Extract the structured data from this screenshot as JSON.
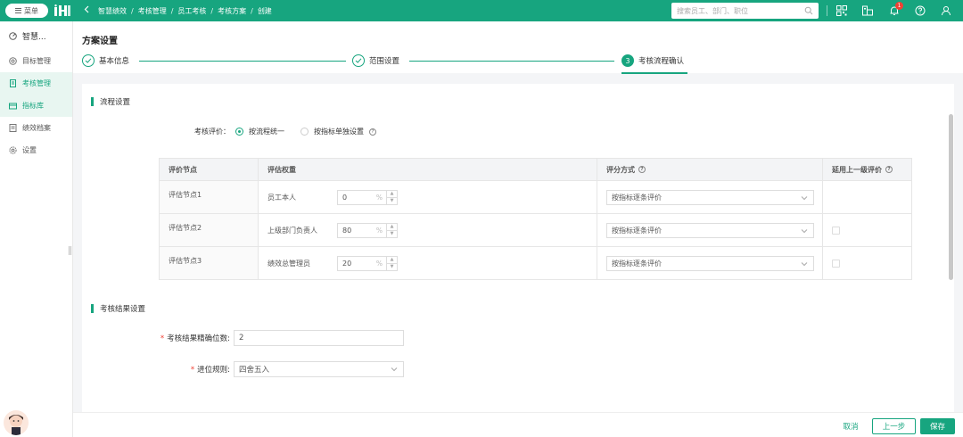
{
  "colors": {
    "brand": "#17a57f",
    "badge": "#f04134"
  },
  "topbar": {
    "menu_label": "菜单",
    "breadcrumb": [
      "智慧绩效",
      "考核管理",
      "员工考核",
      "考核方案",
      "创建"
    ],
    "search_placeholder": "搜索员工、部门、职位",
    "notification_count": "1",
    "icons": [
      "qrcode-icon",
      "org-icon",
      "bell-icon",
      "help-icon",
      "user-icon"
    ]
  },
  "sidebar": {
    "head": "智慧...",
    "items": [
      {
        "label": "目标管理",
        "icon": "target-icon"
      },
      {
        "label": "考核管理",
        "icon": "document-icon"
      },
      {
        "label": "指标库",
        "icon": "box-icon"
      },
      {
        "label": "绩效档案",
        "icon": "archive-icon"
      },
      {
        "label": "设置",
        "icon": "gear-icon"
      }
    ]
  },
  "page": {
    "title": "方案设置",
    "steps": [
      {
        "label": "基本信息",
        "status": "done"
      },
      {
        "label": "范围设置",
        "status": "done"
      },
      {
        "label": "考核流程确认",
        "status": "current",
        "number": "3"
      }
    ]
  },
  "process": {
    "section_title": "流程设置",
    "eval_label": "考核评价：",
    "options": [
      {
        "label": "按流程统一",
        "selected": true
      },
      {
        "label": "按指标单独设置",
        "selected": false
      }
    ],
    "table": {
      "headers": [
        "评价节点",
        "评估权重",
        "评分方式",
        "延用上一级评价"
      ],
      "rows": [
        {
          "node": "评估节点1",
          "role": "员工本人",
          "weight": "0",
          "unit": "%",
          "method": "按指标逐条评价",
          "inherit": null
        },
        {
          "node": "评估节点2",
          "role": "上级部门负责人",
          "weight": "80",
          "unit": "%",
          "method": "按指标逐条评价",
          "inherit": false
        },
        {
          "node": "评估节点3",
          "role": "绩效总管理员",
          "weight": "20",
          "unit": "%",
          "method": "按指标逐条评价",
          "inherit": false
        }
      ]
    }
  },
  "result": {
    "section_title": "考核结果设置",
    "precision_label": "考核结果精确位数:",
    "precision_value": "2",
    "rounding_label": "进位规则:",
    "rounding_value": "四舍五入"
  },
  "footer": {
    "cancel": "取消",
    "prev": "上一步",
    "save": "保存"
  }
}
